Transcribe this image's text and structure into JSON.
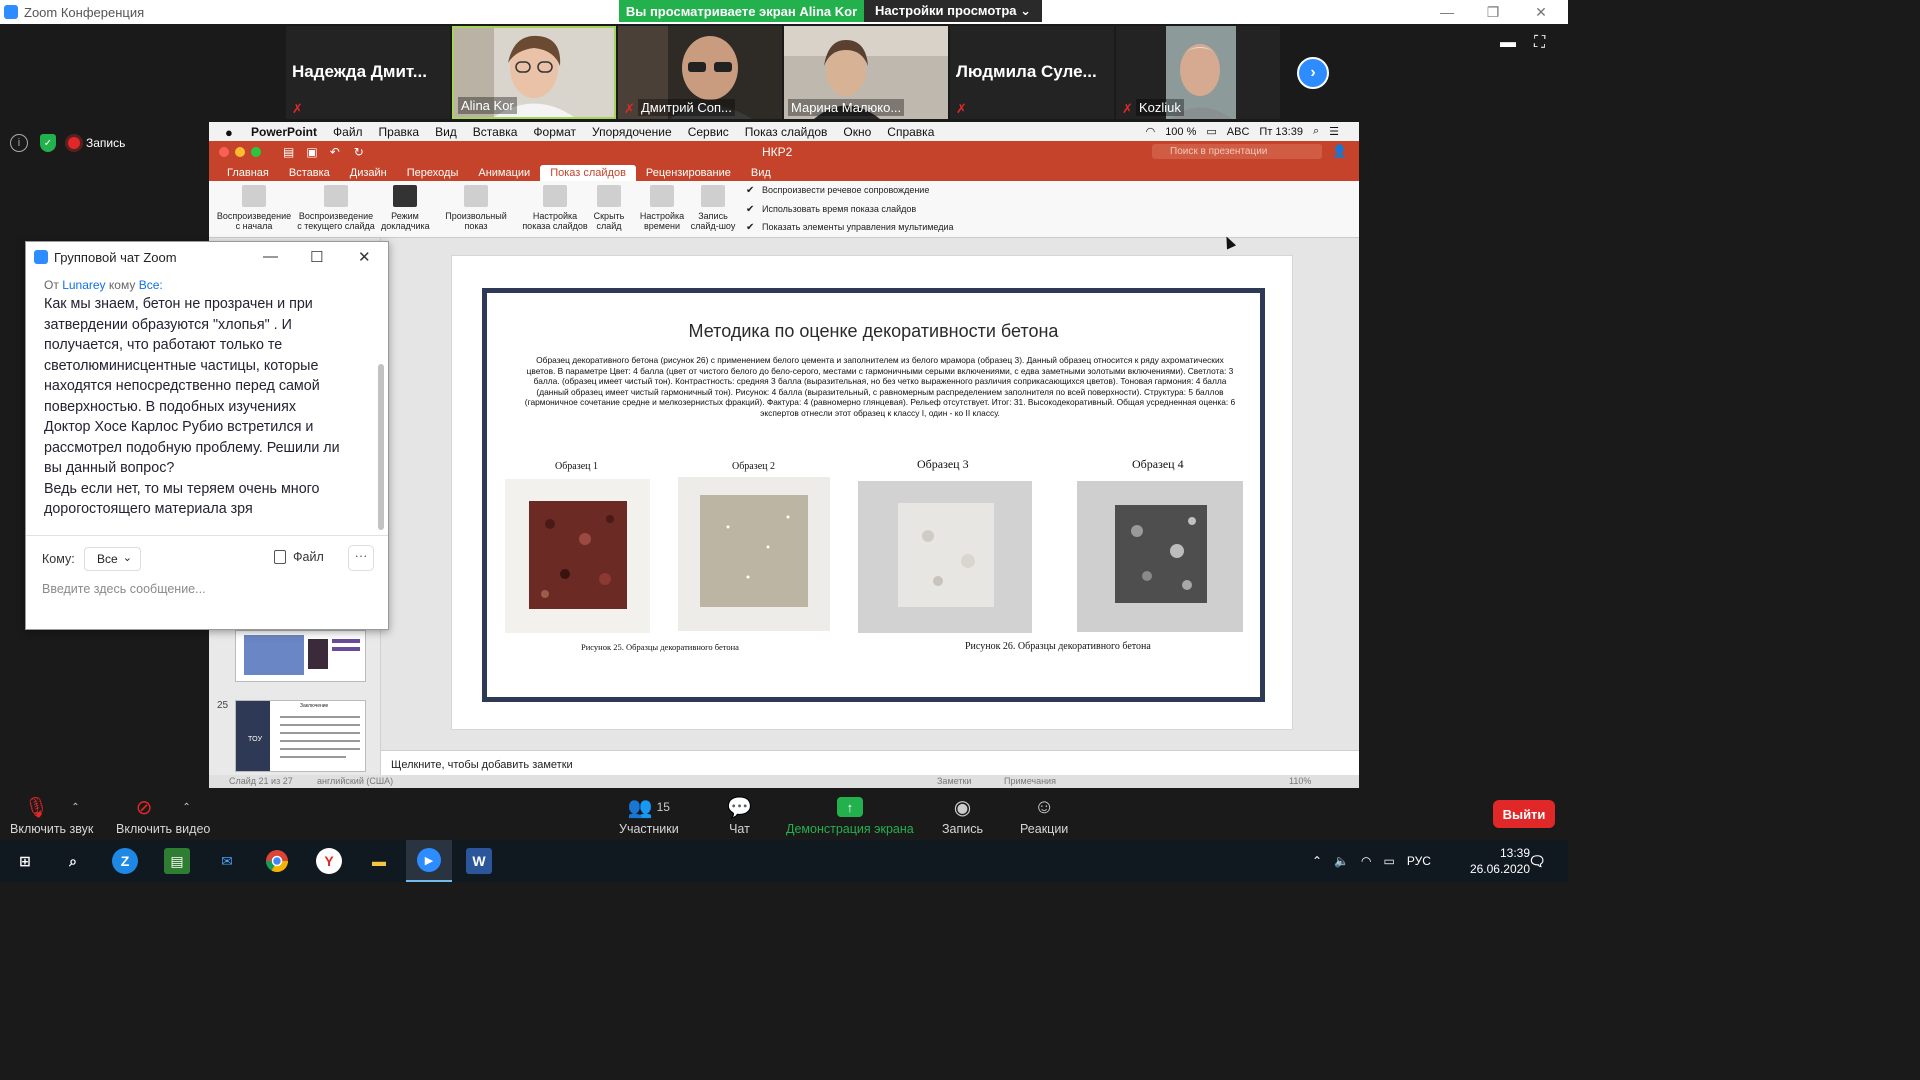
{
  "window": {
    "title": "Zoom Конференция",
    "share_banner": "Вы просматриваете экран Alina Kor",
    "view_settings": "Настройки просмотра ⌄"
  },
  "participants": [
    {
      "name_big": "Надежда Дмит...",
      "label": "",
      "muted": true,
      "video": false
    },
    {
      "name_big": "",
      "label": "Alina Kor",
      "muted": false,
      "video": true
    },
    {
      "name_big": "",
      "label": "Дмитрий Соп...",
      "muted": true,
      "video": true
    },
    {
      "name_big": "",
      "label": "Марина Малюко...",
      "muted": false,
      "video": true
    },
    {
      "name_big": "Людмила Суле...",
      "label": "",
      "muted": true,
      "video": false
    },
    {
      "name_big": "",
      "label": "Kozliuk",
      "muted": true,
      "video": true
    }
  ],
  "status": {
    "recording_label": "Запись"
  },
  "mac": {
    "menu": [
      "PowerPoint",
      "Файл",
      "Правка",
      "Вид",
      "Вставка",
      "Формат",
      "Упорядочение",
      "Сервис",
      "Показ слайдов",
      "Окно",
      "Справка"
    ],
    "battery": "100 %",
    "input_lang": "ABC",
    "clock": "Пт 13:39"
  },
  "ppt": {
    "doc_name": "НКР2",
    "search_placeholder": "Поиск в презентации",
    "tabs": [
      "Главная",
      "Вставка",
      "Дизайн",
      "Переходы",
      "Анимации",
      "Показ слайдов",
      "Рецензирование",
      "Вид"
    ],
    "active_tab": "Показ слайдов",
    "ribbon_buttons": [
      {
        "l1": "Воспроизведение",
        "l2": "с начала"
      },
      {
        "l1": "Воспроизведение",
        "l2": "с текущего слайда"
      },
      {
        "l1": "Режим",
        "l2": "докладчика"
      },
      {
        "l1": "Произвольный",
        "l2": "показ"
      },
      {
        "l1": "Настройка",
        "l2": "показа слайдов"
      },
      {
        "l1": "Скрыть",
        "l2": "слайд"
      },
      {
        "l1": "Настройка",
        "l2": "времени"
      },
      {
        "l1": "Запись",
        "l2": "слайд-шоу"
      }
    ],
    "checks": [
      "Воспроизвести речевое сопровождение",
      "Использовать время показа слайдов",
      "Показать элементы управления мультимедиа"
    ],
    "thumb_number": "25",
    "thumb_title": "Заключение",
    "notes_placeholder": "Щелкните, чтобы добавить заметки",
    "status_left": "Слайд 21 из 27",
    "status_lang": "английский (США)",
    "status_notes": "Заметки",
    "status_comments": "Примечания",
    "zoom": "110%"
  },
  "slide": {
    "title": "Методика по оценке декоративности бетона",
    "body": "Образец декоративного бетона (рисунок 26) с применением белого цемента и заполнителем из белого мрамора (образец 3). Данный образец относится к ряду ахроматических цветов. В параметре Цвет: 4 балла (цвет от чистого белого до бело-серого, местами с гармоничными серыми включениями, с едва заметными золотыми включениями). Светлота: 3 балла. (образец имеет чистый тон). Контрастность: средняя 3 балла (выразительная, но без четко выраженного различия соприкасающихся цветов). Тоновая гармония: 4 балла (данный образец имеет чистый гармоничный тон). Рисунок: 4 балла (выразительный, с равномерным распределением заполнителя по всей поверхности). Структура: 5 баллов (гармоничное сочетание средне и мелкозернистых фракций). Фактура: 4 (равномерно глянцевая). Рельеф отсутствует. Итог: 31. Высокодекоративный. Общая усредненная оценка: 6 экспертов отнесли этот образец к классу I, один - ко II классу.",
    "samples": [
      "Образец 1",
      "Образец 2",
      "Образец 3",
      "Образец 4"
    ],
    "caption_left": "Рисунок 25. Образцы декоративного бетона",
    "caption_right": "Рисунок 26. Образцы декоративного бетона"
  },
  "chat": {
    "title": "Групповой чат Zoom",
    "from_prefix": "От",
    "from_user": "Lunarey",
    "to_word": "кому",
    "to_user": "Все:",
    "message": "Как мы знаем, бетон не прозрачен и при затвердении образуются \"хлопья\" . И получается, что работают только те светолюминисцентные частицы, которые находятся непосредственно перед самой поверхностью. В подобных изучениях Доктор Хосе Карлос Рубио встретился и рассмотрел подобную проблему. Решили ли вы данный вопрос?",
    "message2": "Ведь если нет, то мы теряем очень много дорогостоящего материала зря",
    "to_label": "Кому:",
    "to_value": "Все",
    "file_label": "Файл",
    "input_placeholder": "Введите здесь сообщение..."
  },
  "toolbar": {
    "unmute": "Включить звук",
    "start_video": "Включить видео",
    "participants": "Участники",
    "participants_count": "15",
    "chat": "Чат",
    "share": "Демонстрация экрана",
    "record": "Запись",
    "reactions": "Реакции",
    "leave": "Выйти"
  },
  "taskbar": {
    "lang": "РУС",
    "time": "13:39",
    "date": "26.06.2020"
  }
}
